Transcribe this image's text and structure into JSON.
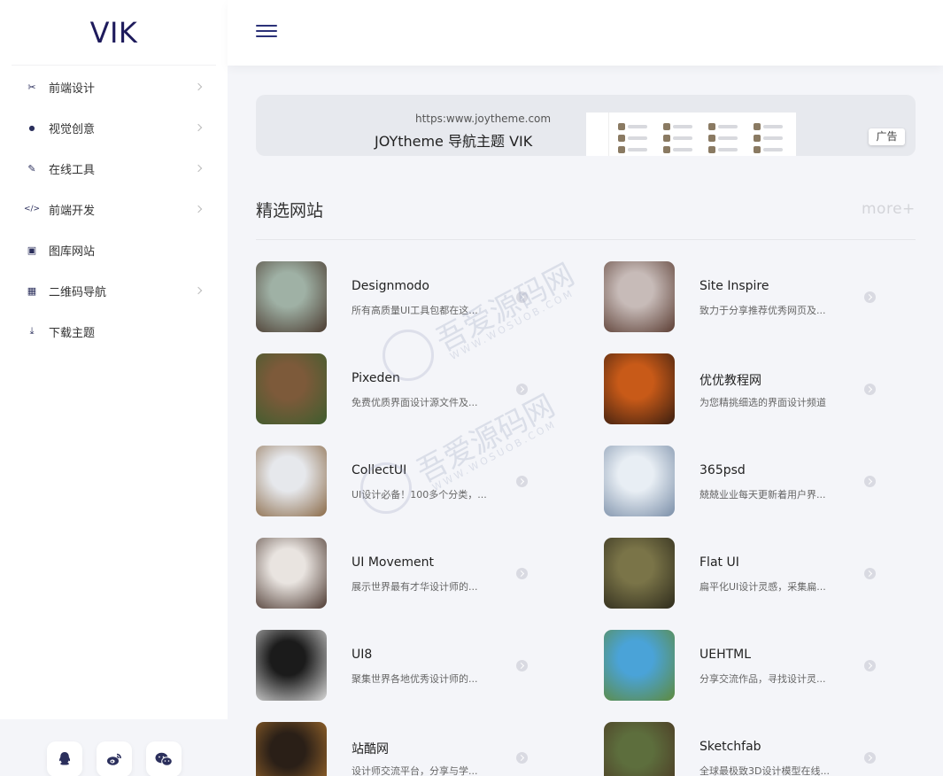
{
  "sidebar": {
    "logo": "VIK",
    "items": [
      {
        "label": "前端设计",
        "icon": "scissors-icon",
        "glyph": "✂",
        "has_submenu": true
      },
      {
        "label": "视觉创意",
        "icon": "droplet-icon",
        "glyph": "●",
        "has_submenu": true
      },
      {
        "label": "在线工具",
        "icon": "pen-icon",
        "glyph": "✎",
        "has_submenu": true
      },
      {
        "label": "前端开发",
        "icon": "code-icon",
        "glyph": "</>",
        "has_submenu": true
      },
      {
        "label": "图库网站",
        "icon": "image-icon",
        "glyph": "▣",
        "has_submenu": false
      },
      {
        "label": "二维码导航",
        "icon": "qrcode-icon",
        "glyph": "▦",
        "has_submenu": true
      },
      {
        "label": "下载主题",
        "icon": "download-icon",
        "glyph": "⤓",
        "has_submenu": false
      }
    ],
    "social": [
      {
        "name": "qq-icon"
      },
      {
        "name": "weibo-icon"
      },
      {
        "name": "wechat-icon"
      }
    ]
  },
  "banner": {
    "url": "https:www.joytheme.com",
    "title": "JOYtheme 导航主题 VIK",
    "ad_label": "广告"
  },
  "section": {
    "title": "精选网站",
    "more": "more+"
  },
  "sites": [
    {
      "name": "Designmodo",
      "desc": "所有高质量UI工具包都在这...",
      "thumb": "dog-on-suitcase",
      "c1": "#9fb1a5",
      "c2": "#4a3a2f"
    },
    {
      "name": "Site Inspire",
      "desc": "致力于分享推荐优秀网页及...",
      "thumb": "puppy-with-lantern",
      "c1": "#c7bbb8",
      "c2": "#5b3d33"
    },
    {
      "name": "Pixeden",
      "desc": "免费优质界面设计源文件及...",
      "thumb": "kitten-in-leaves",
      "c1": "#7d5a3a",
      "c2": "#3e5d2e"
    },
    {
      "name": "优优教程网",
      "desc": "为您精挑细选的界面设计频道",
      "thumb": "dog-autumn",
      "c1": "#c85a18",
      "c2": "#3a1e10"
    },
    {
      "name": "CollectUI",
      "desc": "UI设计必备！100多个分类，...",
      "thumb": "bear-in-river",
      "c1": "#e6e8ec",
      "c2": "#8a6a48"
    },
    {
      "name": "365psd",
      "desc": "兢兢业业每天更新着用户界...",
      "thumb": "kitten-on-blanket",
      "c1": "#e8eef4",
      "c2": "#7a8ea8"
    },
    {
      "name": "UI Movement",
      "desc": "展示世界最有才华设计师的...",
      "thumb": "puppy-in-snow",
      "c1": "#e9e4e0",
      "c2": "#4d3a32"
    },
    {
      "name": "Flat UI",
      "desc": "扁平化UI设计灵感，采集扁...",
      "thumb": "cheetah",
      "c1": "#7a7448",
      "c2": "#2e2b1c"
    },
    {
      "name": "UI8",
      "desc": "聚集世界各地优秀设计师的...",
      "thumb": "white-wolf",
      "c1": "#1b1b1b",
      "c2": "#d8d8d8"
    },
    {
      "name": "UEHTML",
      "desc": "分享交流作品，寻找设计灵...",
      "thumb": "puffin-illustration",
      "c1": "#4aa3d8",
      "c2": "#5e8a3c"
    },
    {
      "name": "站酷网",
      "desc": "设计师交流平台，分享与学...",
      "thumb": "german-shepherd",
      "c1": "#2a1f17",
      "c2": "#a8702e"
    },
    {
      "name": "Sketchfab",
      "desc": "全球最极致3D设计模型在线...",
      "thumb": "brown-bear",
      "c1": "#5d6e3d",
      "c2": "#4a3422"
    }
  ],
  "watermark": {
    "text": "吾爱源码网",
    "sub": "WWW.WOSUOB.COM"
  }
}
